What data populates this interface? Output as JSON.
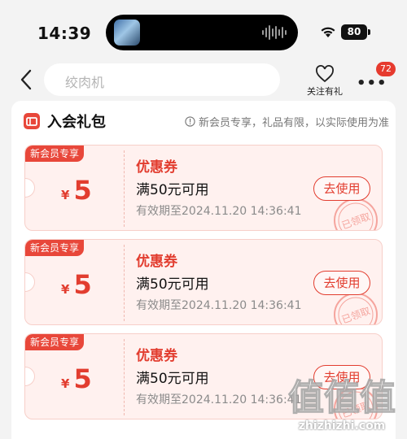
{
  "status_bar": {
    "time": "14:39",
    "battery": "80"
  },
  "nav": {
    "search_placeholder": "绞肉机",
    "follow_label": "关注有礼",
    "message_badge": "72"
  },
  "section": {
    "title": "入会礼包",
    "notice": "新会员专享，礼品有限，以实际使用为准"
  },
  "coupons": [
    {
      "tag": "新会员专享",
      "symbol": "¥",
      "amount": "5",
      "title": "优惠券",
      "condition": "满50元可用",
      "validity": "有效期至2024.11.20 14:36:41",
      "button": "去使用",
      "stamp": "已领取"
    },
    {
      "tag": "新会员专享",
      "symbol": "¥",
      "amount": "5",
      "title": "优惠券",
      "condition": "满50元可用",
      "validity": "有效期至2024.11.20 14:36:41",
      "button": "去使用",
      "stamp": "已领取"
    },
    {
      "tag": "新会员专享",
      "symbol": "¥",
      "amount": "5",
      "title": "优惠券",
      "condition": "满50元可用",
      "validity": "有效期至2024.11.20 14:36:41",
      "button": "去使用",
      "stamp": "已领取"
    }
  ],
  "watermark": {
    "logo_text": "值值值",
    "site": "zhizhizhi.com"
  },
  "colors": {
    "accent": "#e23d2f",
    "coupon_bg": "#fff1ef",
    "page_bg": "#f3f3f3"
  },
  "icons": [
    "back-arrow-icon",
    "heart-icon",
    "more-icon",
    "gift-icon",
    "info-icon",
    "wifi-icon",
    "battery-icon"
  ]
}
